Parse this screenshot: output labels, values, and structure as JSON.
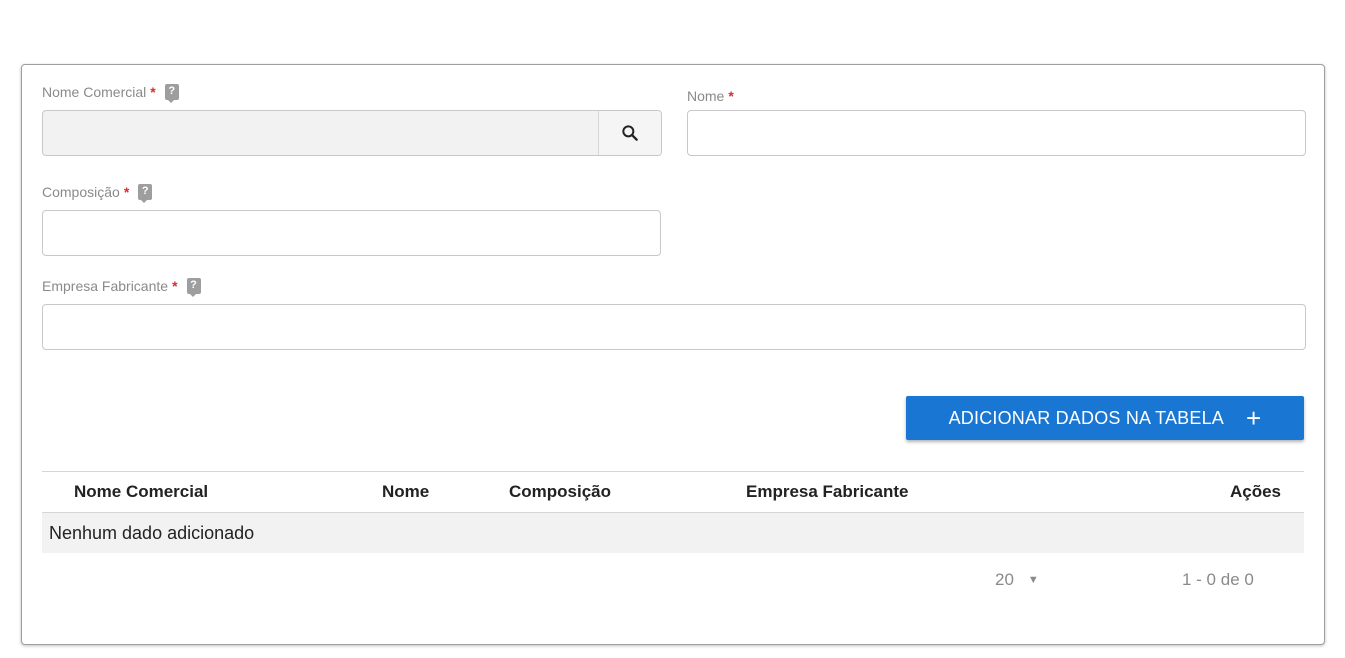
{
  "form": {
    "nome_comercial": {
      "label": "Nome Comercial",
      "required_mark": "*",
      "help": "?",
      "value": "",
      "icon": "search-icon"
    },
    "nome": {
      "label": "Nome",
      "required_mark": "*",
      "value": ""
    },
    "composicao": {
      "label": "Composição",
      "required_mark": "*",
      "help": "?",
      "value": ""
    },
    "empresa_fabricante": {
      "label": "Empresa Fabricante",
      "required_mark": "*",
      "help": "?",
      "value": ""
    },
    "add_button": {
      "label": "ADICIONAR DADOS NA TABELA",
      "icon": "+"
    }
  },
  "table": {
    "columns": [
      "Nome Comercial",
      "Nome",
      "Composição",
      "Empresa Fabricante",
      "Ações"
    ],
    "empty_text": "Nenhum dado adicionado"
  },
  "pagination": {
    "page_size": "20",
    "caret": "▼",
    "range": "1 - 0 de 0"
  },
  "colors": {
    "primary": "#1976d2",
    "required": "#d32f2f",
    "disabled_bg": "#f2f2f2"
  }
}
